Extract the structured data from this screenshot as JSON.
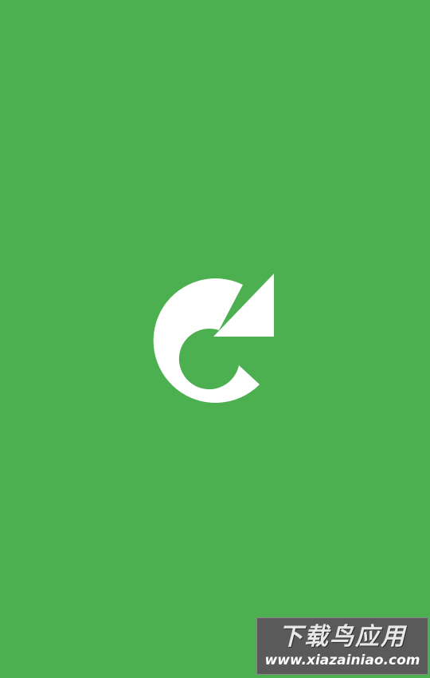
{
  "splash": {
    "background_color": "#4caf50",
    "logo_icon": "refresh-arrow-icon",
    "logo_color": "#ffffff"
  },
  "watermark": {
    "title": "下载鸟应用",
    "url": "www.xiazainiao.com"
  }
}
